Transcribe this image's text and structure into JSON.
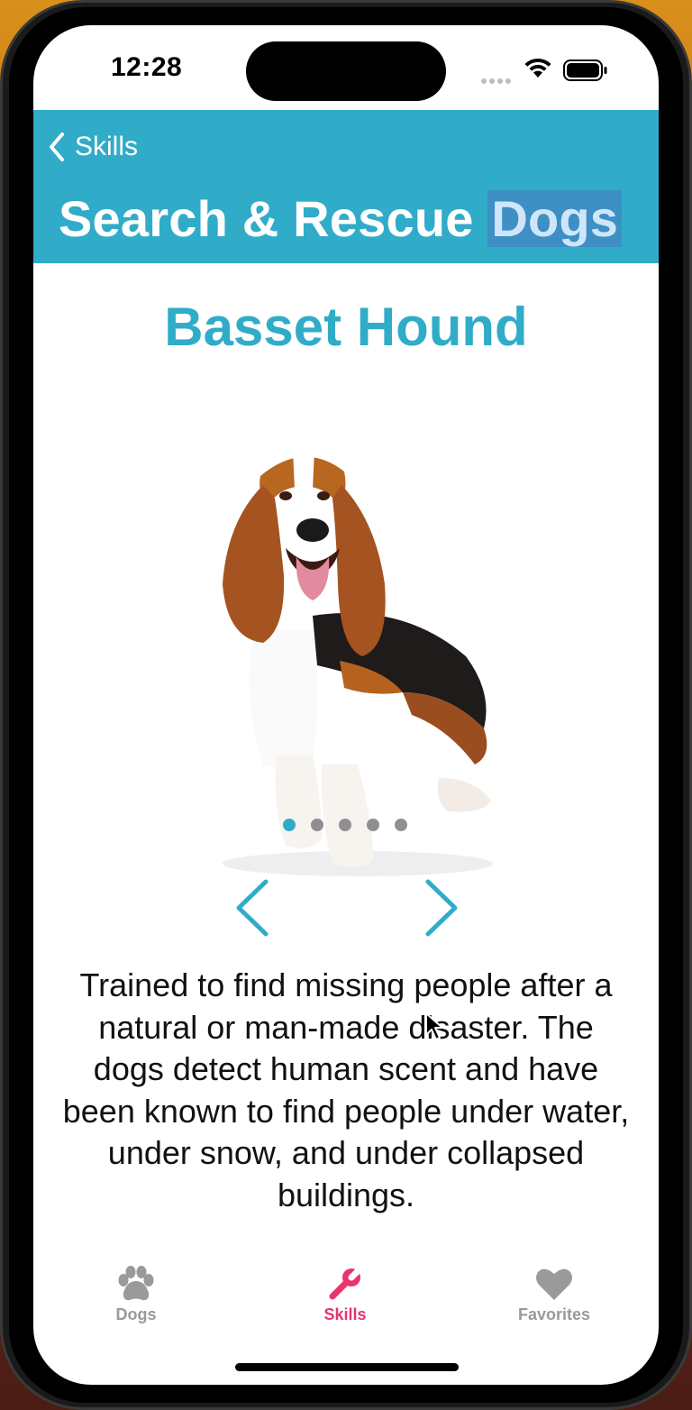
{
  "status_bar": {
    "time": "12:28"
  },
  "nav": {
    "back_label": "Skills",
    "title_main": "Search & Rescue",
    "title_highlight": "Dogs"
  },
  "content": {
    "breed_name": "Basset Hound",
    "dog_image": "basset-hound-photo",
    "page_count": 5,
    "current_page": 1,
    "description": "Trained to find missing people after a natural or man-made disaster. The dogs detect human scent and have been known to find people under water, under snow, and under collapsed buildings."
  },
  "tabs": [
    {
      "label": "Dogs",
      "icon": "paw-icon",
      "selected": false
    },
    {
      "label": "Skills",
      "icon": "wrench-icon",
      "selected": true
    },
    {
      "label": "Favorites",
      "icon": "heart-icon",
      "selected": false
    }
  ],
  "colors": {
    "accent": "#30acc8",
    "tab_selected": "#e8356b",
    "tab_inactive": "#9a9a9a"
  }
}
